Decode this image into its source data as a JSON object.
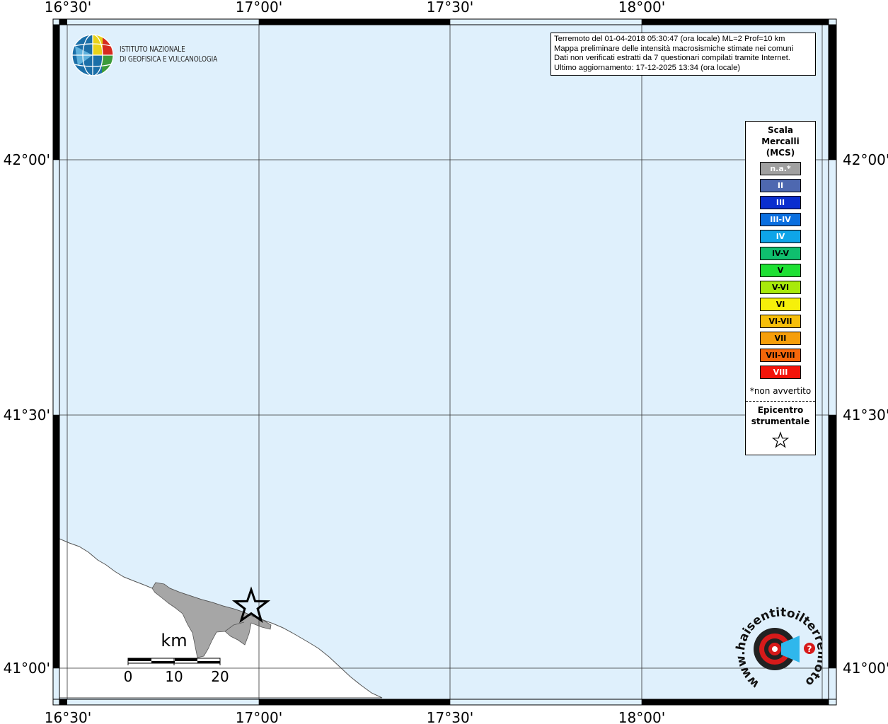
{
  "map": {
    "lon_labels": [
      "16°30'",
      "17°00'",
      "17°30'",
      "18°00'"
    ],
    "lat_labels": [
      "42°00'",
      "41°30'",
      "41°00'"
    ],
    "colors": {
      "sea": "#dff0fc",
      "land": "#ffffff",
      "municipality": "#a6a6a6"
    },
    "scale_bar": {
      "unit": "km",
      "ticks": [
        "0",
        "10",
        "20"
      ]
    }
  },
  "info": {
    "line1": "Terremoto del 01-04-2018 05:30:47 (ora locale) ML=2 Prof=10 km",
    "line2": "Mappa preliminare delle intensità macrosismiche stimate nei comuni",
    "line3": "Dati non verificati estratti da 7 questionari compilati tramite Internet.",
    "line4": "Ultimo aggiornamento: 17-12-2025 13:34 (ora locale)"
  },
  "legend": {
    "title_lines": [
      "Scala",
      "Mercalli",
      "(MCS)"
    ],
    "items": [
      {
        "label": "n.a.*",
        "color": "#a0a0a0"
      },
      {
        "label": "II",
        "color": "#4e68b0"
      },
      {
        "label": "III",
        "color": "#0a2ecf"
      },
      {
        "label": "III-IV",
        "color": "#0a6fe0"
      },
      {
        "label": "IV",
        "color": "#0ea5e8"
      },
      {
        "label": "IV-V",
        "color": "#0fbf6e"
      },
      {
        "label": "V",
        "color": "#1ee033"
      },
      {
        "label": "V-VI",
        "color": "#a8ea0a"
      },
      {
        "label": "VI",
        "color": "#f6f00a"
      },
      {
        "label": "VI-VII",
        "color": "#f6be0a"
      },
      {
        "label": "VII",
        "color": "#f69e0a"
      },
      {
        "label": "VII-VIII",
        "color": "#f4660a"
      },
      {
        "label": "VIII",
        "color": "#f4140a"
      }
    ],
    "note": "*non avvertito",
    "epicenter_lines": [
      "Epicentro",
      "strumentale"
    ],
    "epicenter_icon": "star-icon"
  },
  "logos": {
    "ingv": {
      "line1": "ISTITUTO NAZIONALE",
      "line2": "DI GEOFISICA E VULCANOLOGIA"
    },
    "hsit": {
      "text": "www.haisentitoilterremoto.it"
    }
  }
}
